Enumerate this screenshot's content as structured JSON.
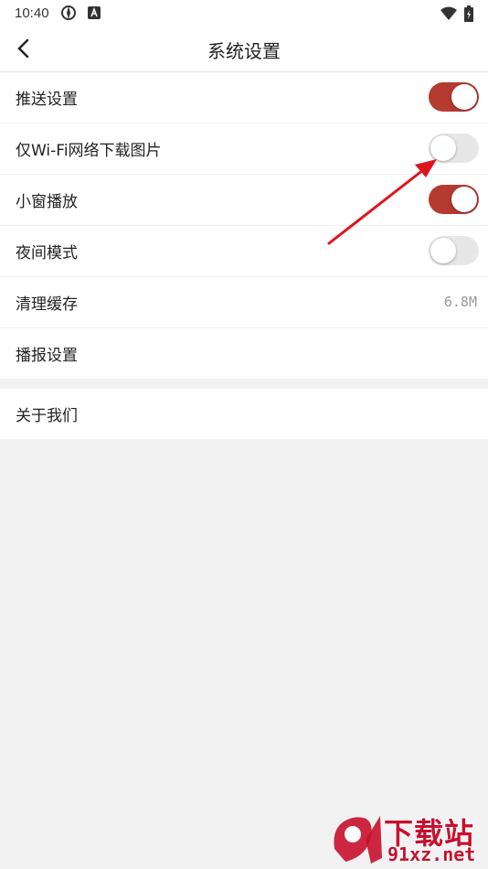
{
  "status_bar": {
    "time": "10:40"
  },
  "nav": {
    "title": "系统设置"
  },
  "settings": [
    {
      "label": "推送设置",
      "toggle": true
    },
    {
      "label": "仅Wi-Fi网络下载图片",
      "toggle": false
    },
    {
      "label": "小窗播放",
      "toggle": true
    },
    {
      "label": "夜间模式",
      "toggle": false
    },
    {
      "label": "清理缓存",
      "value": "6.8M"
    },
    {
      "label": "播报设置"
    }
  ],
  "about": {
    "label": "关于我们"
  },
  "watermark": {
    "brand": "下载站",
    "site": "91xz.net"
  },
  "colors": {
    "toggle_on": "#b53a30",
    "toggle_off": "#e7e7e7",
    "arrow": "#e0141e"
  }
}
